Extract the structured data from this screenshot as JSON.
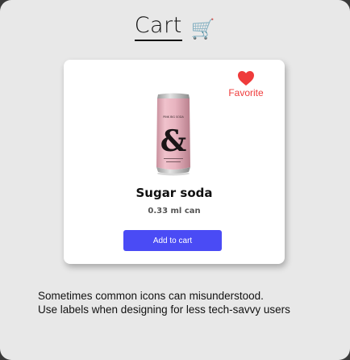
{
  "page": {
    "title": "Cart",
    "title_icon": "🛒"
  },
  "product": {
    "favorite_label": "Favorite",
    "name": "Sugar soda",
    "size": "0.33 ml can",
    "add_button_label": "Add to cart",
    "can_brand_text": "PINK BIG SODA",
    "can_logo_text": "&"
  },
  "caption": {
    "line1": "Sometimes common icons can misunderstood.",
    "line2": "Use labels when designing for less tech-savvy users"
  },
  "colors": {
    "accent": "#4a4bf5",
    "favorite": "#ef3b3b",
    "can": "#e8b4c0"
  }
}
